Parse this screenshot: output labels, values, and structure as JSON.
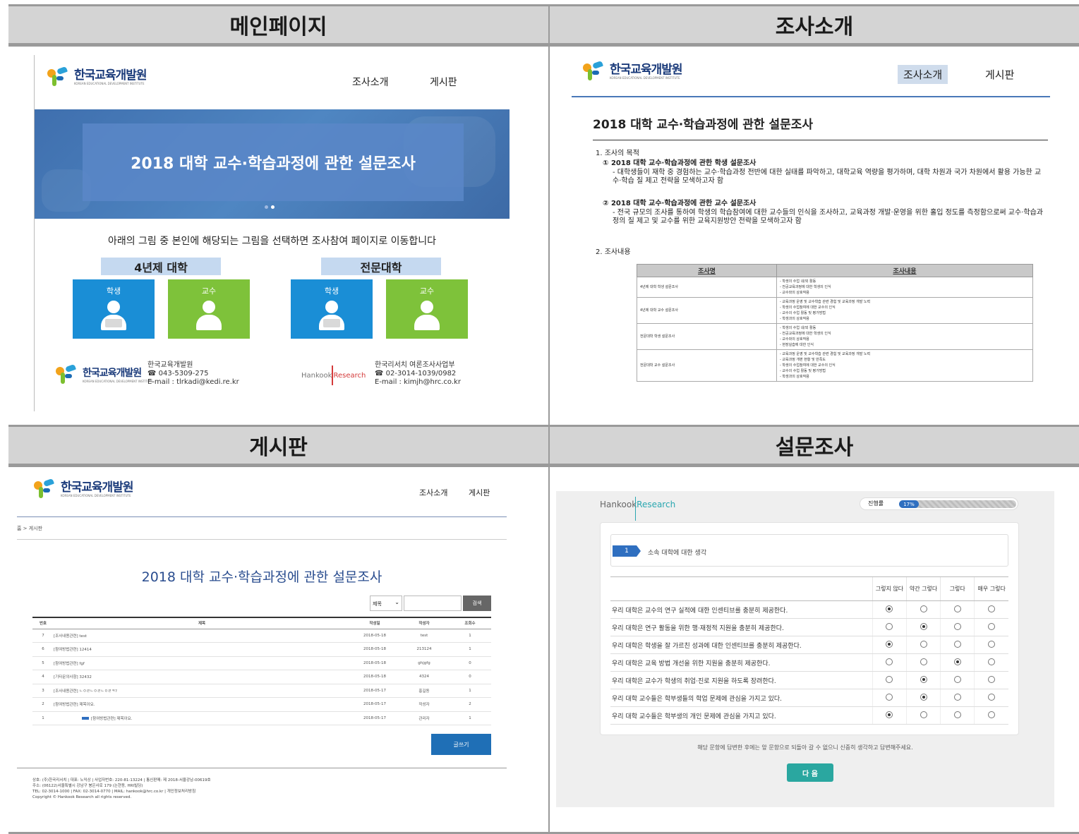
{
  "panels": {
    "main": "메인페이지",
    "intro": "조사소개",
    "board": "게시판",
    "survey": "설문조사"
  },
  "logo": {
    "kor": "한국교육개발원",
    "eng": "KOREAN EDUCATIONAL DEVELOPMENT INSTITUTE"
  },
  "nav": {
    "intro": "조사소개",
    "board": "게시판"
  },
  "main_page": {
    "banner_title": "2018 대학 교수·학습과정에 관한 설문조사",
    "instruction": "아래의 그림 중 본인에 해당되는 그림을 선택하면 조사참여 페이지로 이동합니다",
    "cat_4yr": "4년제 대학",
    "cat_college": "전문대학",
    "student": "학생",
    "professor": "교수",
    "kedi_contact": {
      "name": "한국교육개발원",
      "phone": "☎ 043-5309-275",
      "email": "E-mail : tlrkadi@kedi.re.kr"
    },
    "hk_contact": {
      "name": "한국리서치 여론조사사업부",
      "phone": "☎ 02-3014-1039/0982",
      "email": "E-mail : kimjh@hrc.co.kr"
    },
    "hk_logo_a": "Hankook",
    "hk_logo_b": "Research"
  },
  "intro_page": {
    "title": "2018 대학 교수·학습과정에 관한 설문조사",
    "s1": "1. 조사의 목적",
    "p1_title": "① 2018 대학 교수·학습과정에 관한 학생 설문조사",
    "p1_body": "- 대학생들이 재학 중 경험하는 교수·학습과정 전반에 대한 실태를 파악하고, 대학교육 역량을 평가하며, 대학 차원과 국가 차원에서 활용 가능한 교수·학습 질 제고 전략을 모색하고자 함",
    "p2_title": "② 2018 대학 교수·학습과정에 관한 교수 설문조사",
    "p2_body": "- 전국 규모의 조사를 통하여 학생의 학습참여에 대한 교수들의 인식을 조사하고, 교육과정 개발·운영을 위한 홀입 정도를 측정함으로써 교수·학습과정의 질 제고 및 교수를 위한 교육지원방안 전략을 모색하고자 함",
    "s2": "2. 조사내용",
    "table_head": [
      "조사명",
      "조사내용"
    ],
    "table_rows": [
      {
        "name": "4년제 대학 학생 설문조사",
        "items": [
          "- 학생의 수업 내/외 활동",
          "- 전공교육과정에 대한 학생의 인식",
          "- 교수와의 상호작용"
        ]
      },
      {
        "name": "4년제 대학 교수 설문조사",
        "items": [
          "- 교육과정 운영 및 교수학습 관련 경험 및 교육과정 개발 노력",
          "- 학생의 수업참여에 대한 교수의 인식",
          "- 교수의 수업 활동 및 평가방법",
          "- 학생과의 상호작용"
        ]
      },
      {
        "name": "전문대학 학생 설문조사",
        "items": [
          "- 학생의 수업 내/외 활동",
          "- 전공교육과정에 대한 학생의 인식",
          "- 교수와의 상호작용",
          "- 현장실습에 대한 인식"
        ]
      },
      {
        "name": "전문대학 교수 설문조사",
        "items": [
          "- 교육과정 운영 및 교수학습 관련 경험 및 교육과정 개발 노력",
          "- 교육과정 개편 현황 및 만족도",
          "- 학생의 수업참여에 대한 교수의 인식",
          "- 교수의 수업 활동 및 평가방법",
          "- 학생과의 상호작용"
        ]
      }
    ]
  },
  "board_page": {
    "breadcrumb": "홈 > 게시판",
    "title": "2018 대학 교수·학습과정에 관한 설문조사",
    "select_value": "제목",
    "search_button": "검색",
    "columns": [
      "번호",
      "제목",
      "작성일",
      "작성자",
      "조회수"
    ],
    "rows": [
      {
        "no": "7",
        "title": "[조사내용관련] test",
        "date": "2018-05-18",
        "author": "test",
        "views": "1"
      },
      {
        "no": "6",
        "title": "[참여방법관련] 12414",
        "date": "2018-05-18",
        "author": "213124",
        "views": "1"
      },
      {
        "no": "5",
        "title": "[참여방법관련] fgf",
        "date": "2018-05-18",
        "author": "ghjgfg",
        "views": "0"
      },
      {
        "no": "4",
        "title": "[기타문의사항] 32432",
        "date": "2018-05-18",
        "author": "4324",
        "views": "0"
      },
      {
        "no": "3",
        "title": "[조사내용관련] ㄴㅇㄹㄴㅇㄹㄴㅇㄹㅋ?",
        "date": "2018-05-17",
        "author": "홍길동",
        "views": "1"
      },
      {
        "no": "2",
        "title": "[참여방법관련] 제목이요.",
        "date": "2018-05-17",
        "author": "작성자",
        "views": "2"
      },
      {
        "no": "1",
        "title": "[참여방법관련] 제목이요.",
        "date": "2018-05-17",
        "author": "관리자",
        "views": "1"
      }
    ],
    "write_button": "글쓰기",
    "footer": [
      "상호: (주)한국리서치 | 대표: 노익상 | 사업자번호: 220-81-13224 | 통신판매: 제 2018-서울강남-00619호",
      "주소: (06122)서울특별시 강남구 봉은사로 179 (논현동, HRI빌딩)",
      "TEL: 02-3014-1000 | FAX: 02-3014-0770 | MAIL: hankook@hrc.co.kr | 개인정보처리방침",
      "Copyright © Hankook Research all rights reserved."
    ]
  },
  "survey_page": {
    "brand_a": "Hankook",
    "brand_b": "Research",
    "progress_label": "진행률",
    "progress_value": "17%",
    "progress_fraction": 0.17,
    "question_no": "1",
    "question_text": "소속 대학에 대한 생각",
    "scale": [
      "그렇지 않다",
      "약간 그렇다",
      "그렇다",
      "매우 그렇다"
    ],
    "items": [
      {
        "text": "우리 대학은 교수의 연구 실적에 대한 인센티브를 충분히 제공한다.",
        "selected": 0
      },
      {
        "text": "우리 대학은 연구 활동을 위한 행·재정적 지원을 충분히 제공한다.",
        "selected": 1
      },
      {
        "text": "우리 대학은 학생을 잘 가르친 성과에 대한 인센티브를 충분히 제공한다.",
        "selected": 0
      },
      {
        "text": "우리 대학은 교육 방법 개선을 위한 지원을 충분히 제공한다.",
        "selected": 2
      },
      {
        "text": "우리 대학은 교수가 학생의 취업·진로 지원을 하도록 장려한다.",
        "selected": 1
      },
      {
        "text": "우리 대학 교수들은 학부생들의 학업 문제에 관심을 가지고 있다.",
        "selected": 1
      },
      {
        "text": "우리 대학 교수들은 학부생의 개인 문제에 관심을 가지고 있다.",
        "selected": 0
      }
    ],
    "notice": "해당 문항에 답변한 후에는 앞 문항으로 되돌아 갈 수 없으니 신중히 생각하고 답변해주세요.",
    "next_button": "다 음"
  }
}
